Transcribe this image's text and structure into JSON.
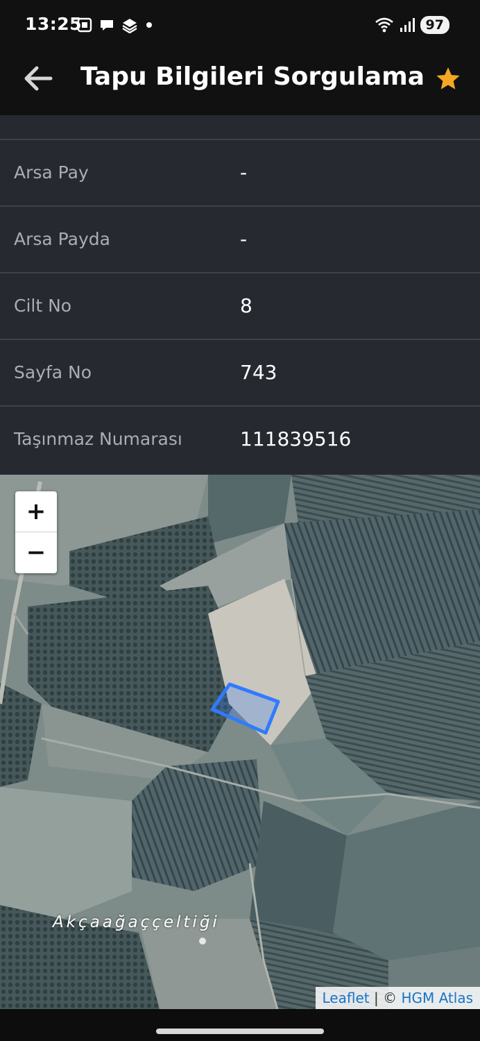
{
  "status_bar": {
    "time": "13:25",
    "battery": "97",
    "icons": [
      "screenshot-icon",
      "chat-bubble-icon",
      "stacked-app-icon",
      "notification-dot-icon",
      "wifi-icon",
      "signal-icon",
      "battery-icon"
    ]
  },
  "app_bar": {
    "title": "Tapu Bilgileri Sorgulama",
    "back_icon": "arrow-left-icon",
    "favorite_icon": "star-icon",
    "star_color": "#f5a623"
  },
  "info_rows": [
    {
      "label": "Arsa Pay",
      "value": "-"
    },
    {
      "label": "Arsa Payda",
      "value": "-"
    },
    {
      "label": "Cilt No",
      "value": "8"
    },
    {
      "label": "Sayfa No",
      "value": "743"
    },
    {
      "label": "Taşınmaz Numarası",
      "value": "111839516"
    }
  ],
  "map": {
    "zoom_in": "+",
    "zoom_out": "−",
    "place_label": "Akçaağaççeltiği",
    "attribution_leaflet": "Leaflet",
    "attribution_sep": " | © ",
    "attribution_source": "HGM Atlas",
    "parcel_color": "#2f7bff"
  }
}
